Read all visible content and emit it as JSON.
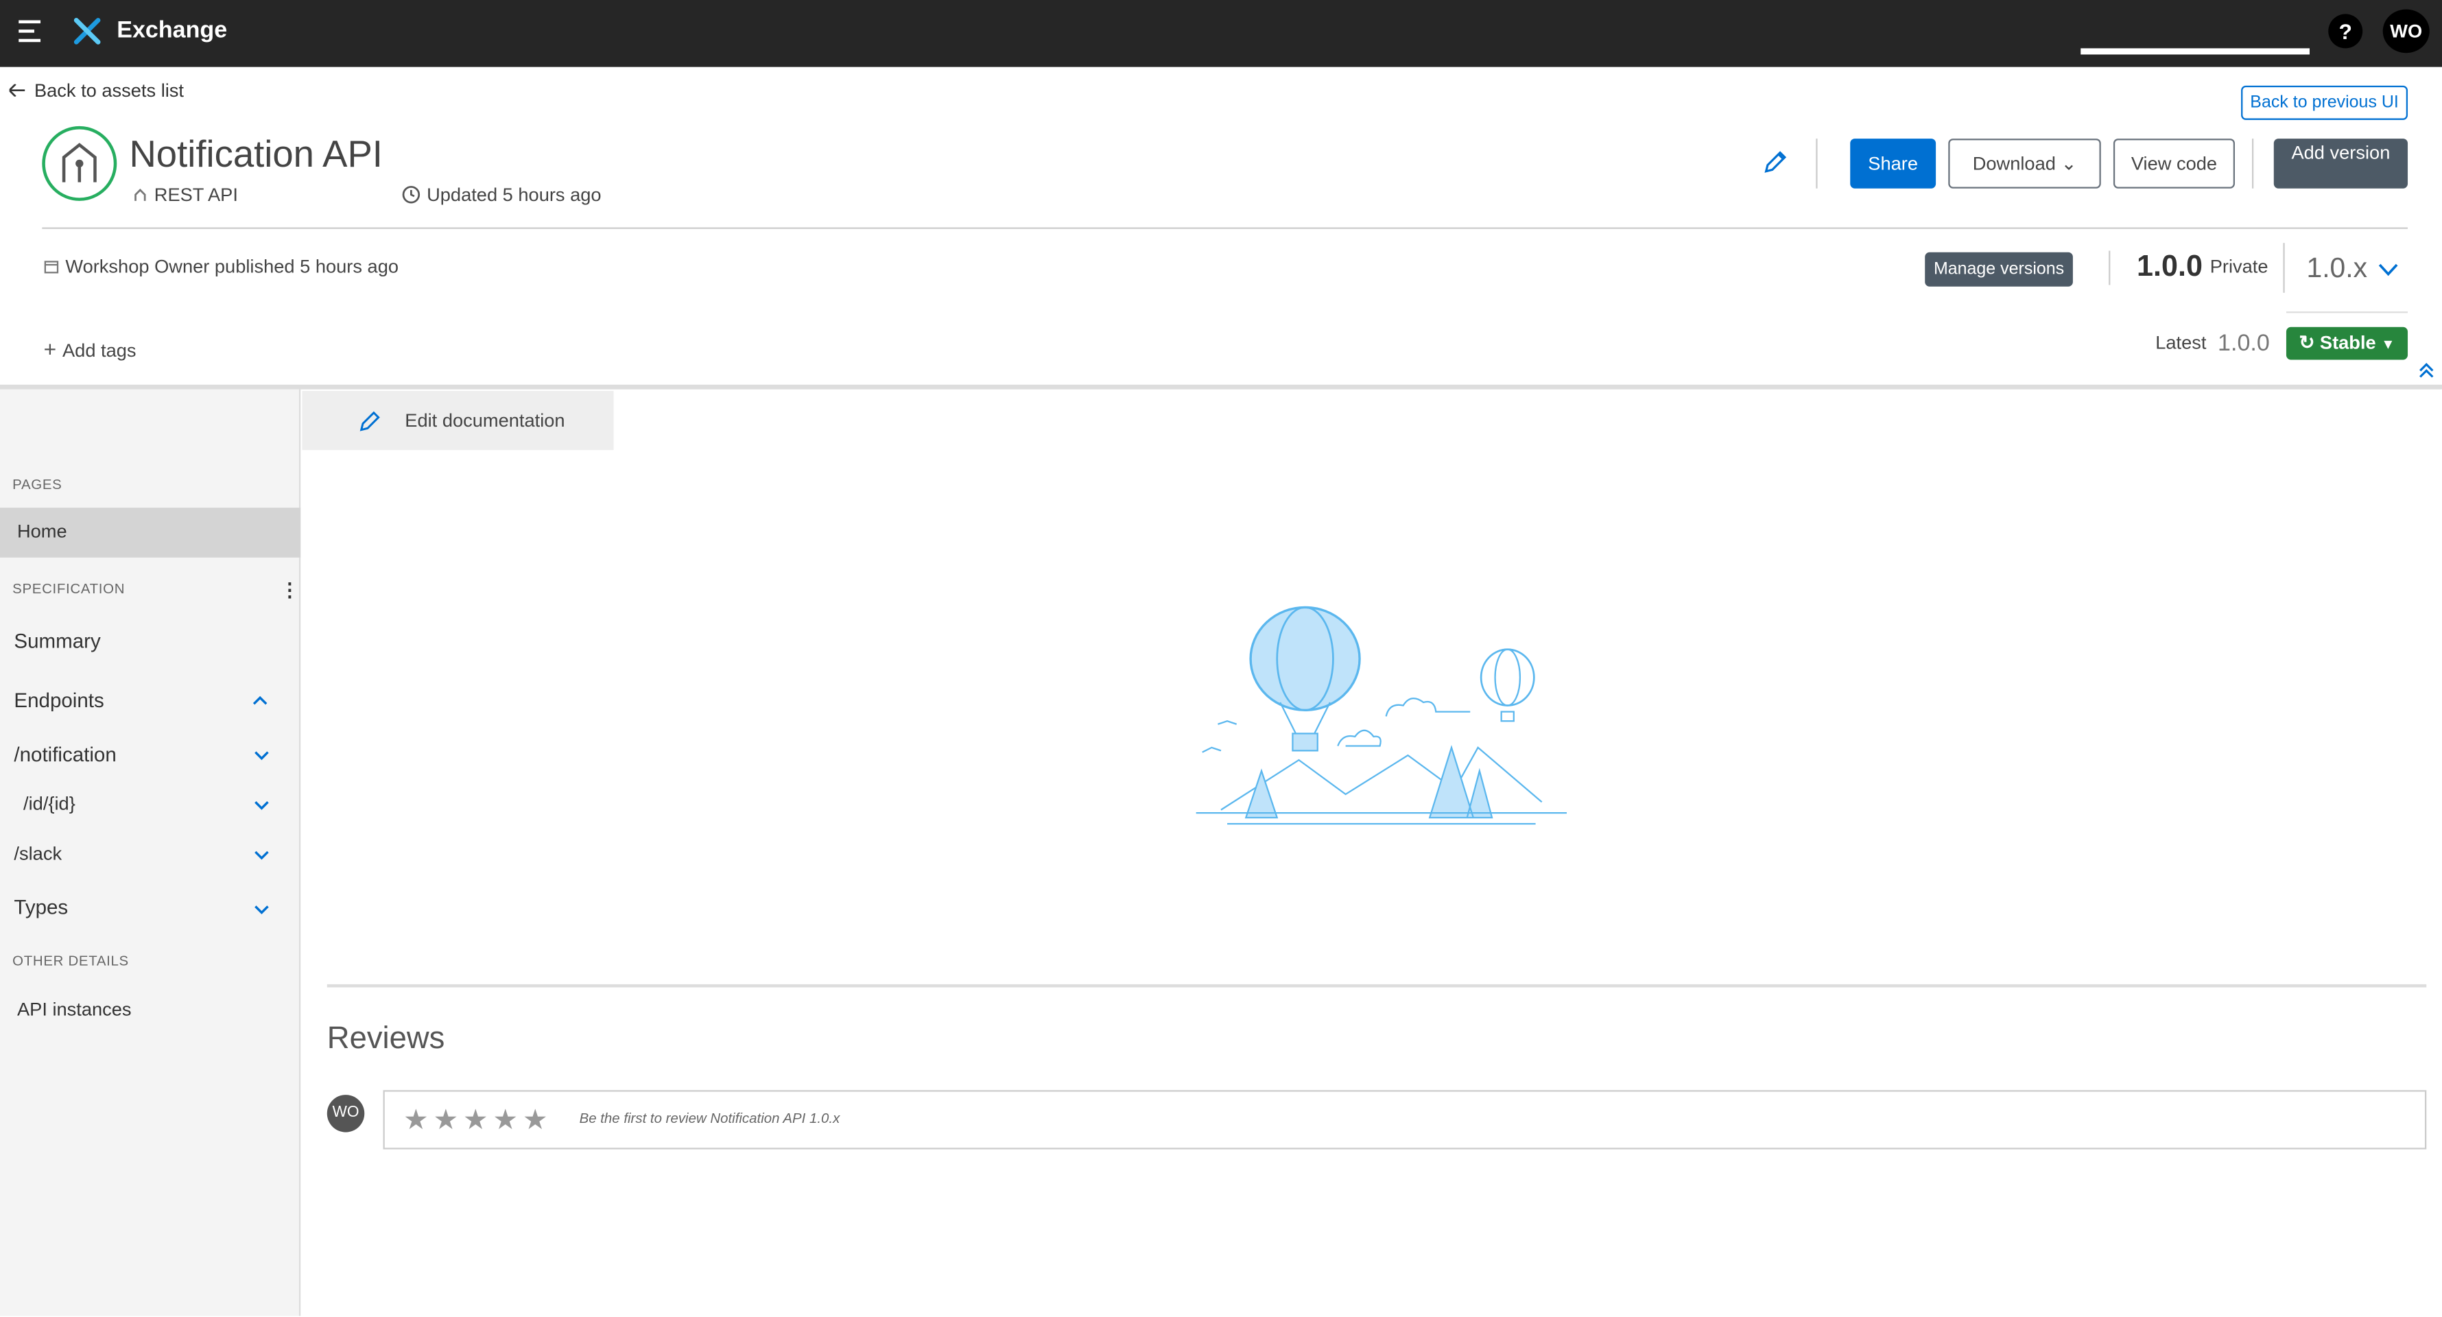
{
  "topbar": {
    "brand": "Exchange",
    "help": "?",
    "avatar": "WO"
  },
  "header": {
    "back_link": "Back to assets list",
    "back_prev_ui": "Back to previous UI",
    "title": "Notification API",
    "asset_type": "REST API",
    "updated": "Updated 5 hours ago",
    "published": "Workshop Owner published 5 hours ago",
    "add_tags": "Add tags",
    "buttons": {
      "share": "Share",
      "download": "Download",
      "view_code": "View code",
      "add_version": "Add version",
      "manage_versions": "Manage versions"
    },
    "version": "1.0.0",
    "visibility": "Private",
    "version_group": "1.0.x",
    "latest_label": "Latest",
    "latest_version": "1.0.0",
    "stability": "Stable"
  },
  "sidebar": {
    "pages_label": "PAGES",
    "home": "Home",
    "spec_label": "SPECIFICATION",
    "summary": "Summary",
    "endpoints": "Endpoints",
    "ep_notification": "/notification",
    "ep_id": "/id/{id}",
    "ep_slack": "/slack",
    "types": "Types",
    "other_label": "OTHER DETAILS",
    "api_instances": "API instances"
  },
  "main": {
    "edit_doc": "Edit documentation",
    "reviews_title": "Reviews",
    "reviewer_avatar": "WO",
    "stars": "★★★★★",
    "review_prompt": "Be the first to review Notification API 1.0.x"
  },
  "colors": {
    "accent": "#0070d2",
    "stable": "#27863d",
    "topbar": "#262626",
    "asset_icon": "#27ae60"
  }
}
